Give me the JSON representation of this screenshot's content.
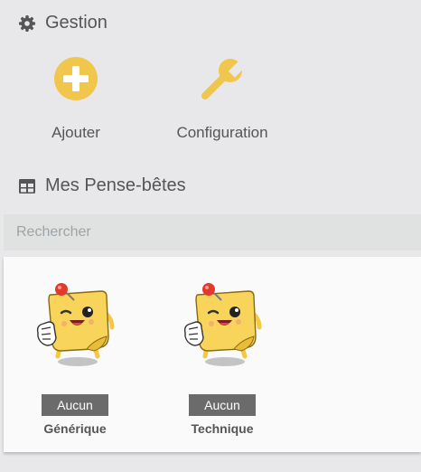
{
  "gestion": {
    "title": "Gestion",
    "icon": "gear-icon",
    "actions": [
      {
        "label": "Ajouter",
        "icon": "plus-circle-icon"
      },
      {
        "label": "Configuration",
        "icon": "wrench-icon"
      }
    ]
  },
  "notes_section": {
    "title": "Mes Pense-bêtes",
    "icon": "table-icon"
  },
  "search": {
    "placeholder": "Rechercher",
    "value": ""
  },
  "notes": [
    {
      "badge": "Aucun",
      "name": "Générique",
      "icon": "sticky-note-mascot-icon"
    },
    {
      "badge": "Aucun",
      "name": "Technique",
      "icon": "sticky-note-mascot-icon"
    }
  ],
  "colors": {
    "accent": "#f0c64c",
    "background": "#e8e8ea",
    "badge": "#6b6b6b",
    "text": "#555555"
  }
}
